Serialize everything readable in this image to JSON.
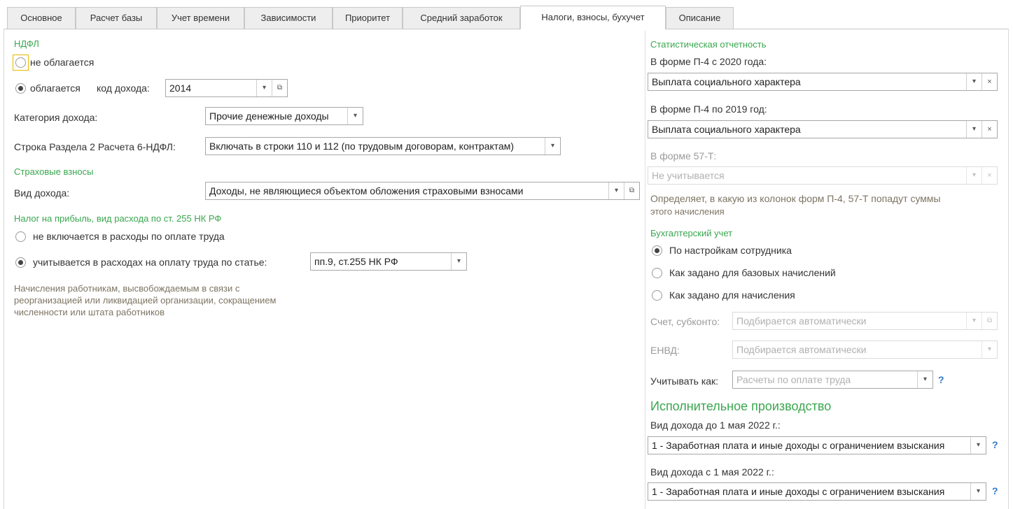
{
  "tabs": [
    "Основное",
    "Расчет базы",
    "Учет времени",
    "Зависимости",
    "Приоритет",
    "Средний заработок",
    "Налоги, взносы, бухучет",
    "Описание"
  ],
  "active_tab": "Налоги, взносы, бухучет",
  "ndfl": {
    "section_title": "НДФЛ",
    "not_taxed_label": "не облагается",
    "taxed_label": "облагается",
    "income_code_label": "код дохода:",
    "income_code_value": "2014",
    "income_category_label": "Категория дохода:",
    "income_category_value": "Прочие денежные доходы",
    "line_6ndfl_label": "Строка Раздела 2 Расчета 6-НДФЛ:",
    "line_6ndfl_value": "Включать в строки 110 и 112 (по трудовым договорам, контрактам)"
  },
  "insurance": {
    "section_title": "Страховые взносы",
    "income_type_label": "Вид дохода:",
    "income_type_value": "Доходы, не являющиеся объектом обложения страховыми взносами"
  },
  "profit_tax": {
    "section_title": "Налог на прибыль, вид расхода по ст. 255 НК РФ",
    "not_included_label": "не включается в расходы по оплате труда",
    "included_label": "учитывается в расходах на оплату труда по статье:",
    "article_value": "пп.9, ст.255 НК РФ",
    "hint": [
      "Начисления работникам, высвобождаемым в связи с",
      "реорганизацией или ликвидацией организации, сокращением",
      "численности или штата работников"
    ]
  },
  "statistics": {
    "section_title": "Статистическая отчетность",
    "p4_2020_label": "В форме П-4 с 2020 года:",
    "p4_2020_value": "Выплата социального характера",
    "p4_2019_label": "В форме П-4 по 2019 год:",
    "p4_2019_value": "Выплата социального характера",
    "f57t_label": "В форме 57-Т:",
    "f57t_value": "Не учитывается",
    "hint": [
      "Определяет, в какую из колонок форм П-4, 57-Т попадут суммы",
      "этого начисления"
    ]
  },
  "accounting": {
    "section_title": "Бухгалтерский учет",
    "opt_employee": "По настройкам сотрудника",
    "opt_base": "Как задано для базовых начислений",
    "opt_accrual": "Как задано для начисления",
    "account_label": "Счет, субконто:",
    "account_value": "Подбирается автоматически",
    "envd_label": "ЕНВД:",
    "envd_value": "Подбирается автоматически",
    "consider_as_label": "Учитывать как:",
    "consider_as_value": "Расчеты по оплате труда"
  },
  "enforcement": {
    "section_title": "Исполнительное производство",
    "before_label": "Вид дохода до 1 мая 2022 г.:",
    "before_value": "1 - Заработная плата и иные доходы с ограничением взыскания",
    "after_label": "Вид дохода с 1 мая 2022 г.:",
    "after_value": "1 - Заработная плата и иные доходы с ограничением взыскания"
  },
  "icons": {
    "dropdown": "▾",
    "open": "⧉",
    "clear": "×",
    "help": "?"
  },
  "colors": {
    "section_green": "#3aa64f",
    "hint_brown": "#7d7462",
    "focus_yellow": "#e6b800",
    "help_blue": "#2f78c8"
  }
}
